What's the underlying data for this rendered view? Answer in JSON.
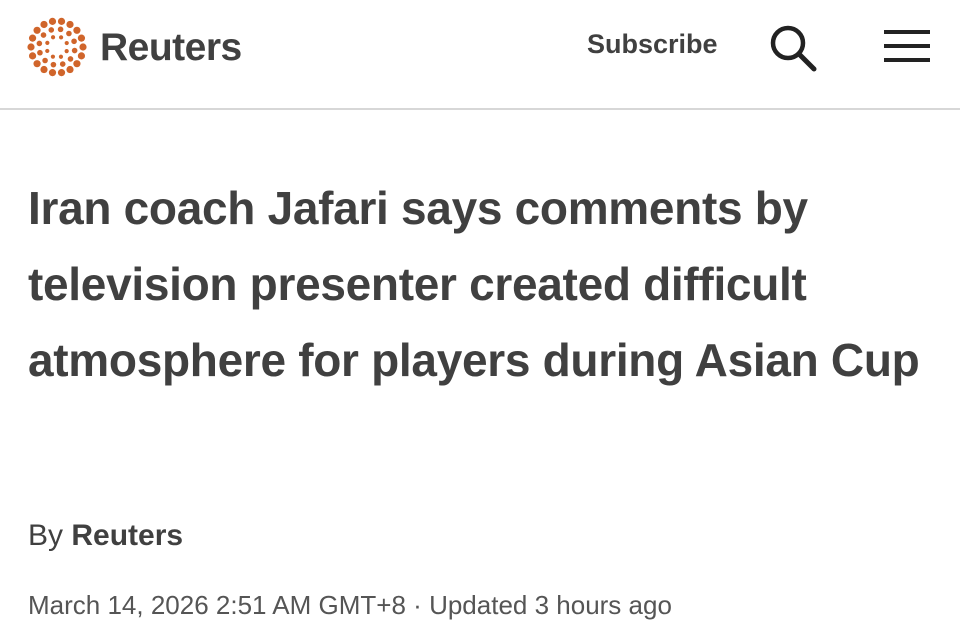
{
  "header": {
    "logo_text": "Reuters",
    "subscribe_label": "Subscribe",
    "search_icon": "search-icon",
    "menu_icon": "hamburger-menu-icon",
    "brand_color": "#d0652b"
  },
  "article": {
    "headline": "Iran coach Jafari says comments by television presenter created difficult atmosphere for players during Asian Cup",
    "byline_prefix": "By",
    "author": "Reuters",
    "published": "March 14, 2026 2:51 AM GMT+8",
    "separator": "·",
    "updated": "Updated 3 hours ago"
  }
}
